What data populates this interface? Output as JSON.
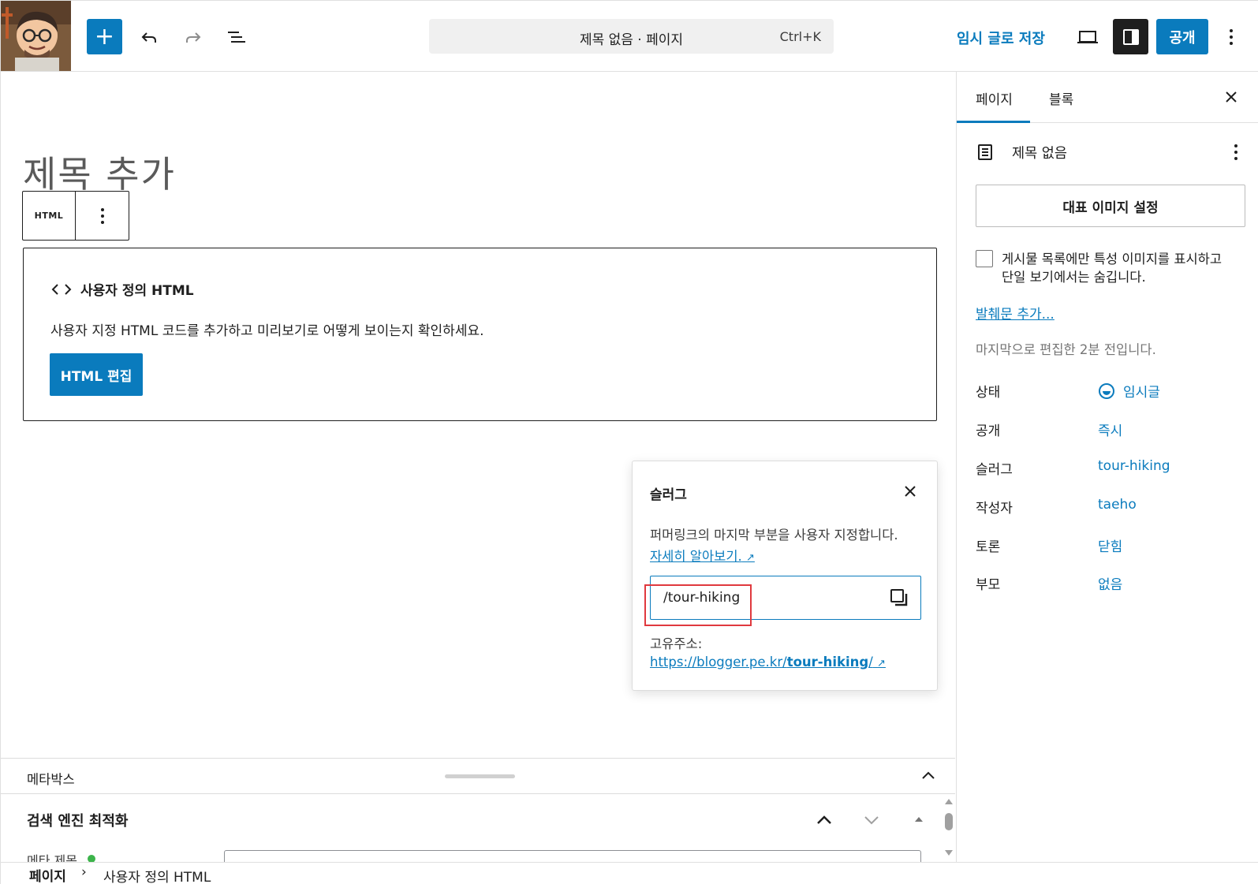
{
  "toolbar": {
    "add_label": "+",
    "document_title": "제목 없음 · 페이지",
    "shortcut": "Ctrl+K",
    "save_draft": "임시 글로 저장",
    "publish": "공개"
  },
  "editor": {
    "title_placeholder": "제목 추가",
    "block_toolbar_label": "HTML",
    "html_block": {
      "heading": "사용자 정의 HTML",
      "description": "사용자 지정 HTML 코드를 추가하고 미리보기로 어떻게 보이는지 확인하세요.",
      "edit_button": "HTML 편집"
    }
  },
  "slug_popover": {
    "title": "슬러그",
    "help": "퍼머링크의 마지막 부분을 사용자 지정합니다.",
    "learn_more": "자세히 알아보기.",
    "value": "/tour-hiking",
    "permalink_label": "고유주소:",
    "permalink_prefix": "https://blogger.pe.kr/",
    "permalink_slug": "tour-hiking",
    "permalink_suffix": "/"
  },
  "metabox": {
    "label": "메타박스",
    "seo_title": "검색 엔진 최적화",
    "meta_title_label": "메타 제목"
  },
  "footer": {
    "root": "페이지",
    "separator": "›",
    "current": "사용자 정의 HTML"
  },
  "sidebar": {
    "tabs": [
      {
        "label": "페이지",
        "active": true
      },
      {
        "label": "블록",
        "active": false
      }
    ],
    "doc_name": "제목 없음",
    "featured_image_button": "대표 이미지 설정",
    "hide_featured_text": "게시물 목록에만 특성 이미지를 표시하고 단일 보기에서는 숨깁니다.",
    "excerpt_link": "발췌문 추가...",
    "last_edited": "마지막으로 편집한 2분 전입니다.",
    "properties": [
      {
        "label": "상태",
        "value": "임시글"
      },
      {
        "label": "공개",
        "value": "즉시"
      },
      {
        "label": "슬러그",
        "value": "tour-hiking"
      },
      {
        "label": "작성자",
        "value": "taeho"
      },
      {
        "label": "토론",
        "value": "닫힘"
      },
      {
        "label": "부모",
        "value": "없음"
      }
    ]
  },
  "colors": {
    "accent": "#0a7bbd",
    "highlight": "#e0393e",
    "dark": "#1e1e1e"
  }
}
